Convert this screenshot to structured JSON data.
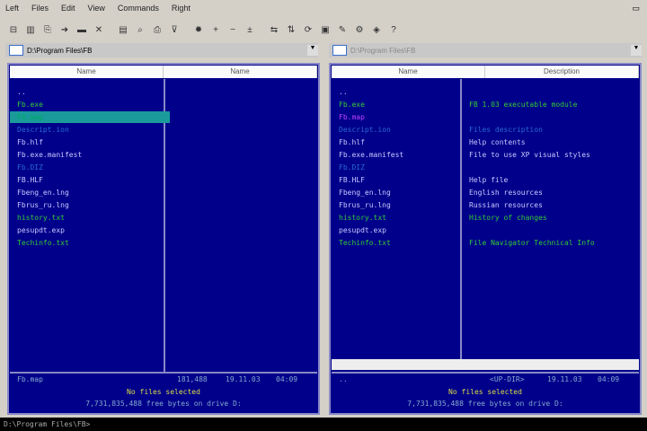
{
  "menu": [
    "Left",
    "Files",
    "Edit",
    "View",
    "Commands",
    "Right"
  ],
  "toolbar_icons": [
    "tree-icon",
    "split-icon",
    "copy-icon",
    "move-icon",
    "folder-icon",
    "delete-icon",
    "properties-icon",
    "find-icon",
    "print-icon",
    "filter-icon",
    "bulb-icon",
    "select-plus-icon",
    "select-minus-icon",
    "invert-icon",
    "compare-icon",
    "sort-icon",
    "refresh-icon",
    "view-icon",
    "edit-icon",
    "tools-icon",
    "plugins-icon",
    "help-icon"
  ],
  "left": {
    "path": "D:\\Program Files\\FB",
    "columns": [
      "Name",
      "Name"
    ],
    "files": [
      {
        "name": "..",
        "c": "#c8c8ff"
      },
      {
        "name": "Fb.exe",
        "c": "#33cc33"
      },
      {
        "name": "Fb.map",
        "c": "#0a6"
      },
      {
        "name": "Descript.ion",
        "c": "#2a6ad0"
      },
      {
        "name": "Fb.hlf",
        "c": "#c8c8ff"
      },
      {
        "name": "Fb.exe.manifest",
        "c": "#c8c8ff"
      },
      {
        "name": "Fb.DIZ",
        "c": "#2a6ad0"
      },
      {
        "name": "FB.HLF",
        "c": "#c8c8ff"
      },
      {
        "name": "Fbeng_en.lng",
        "c": "#c8c8ff"
      },
      {
        "name": "Fbrus_ru.lng",
        "c": "#c8c8ff"
      },
      {
        "name": "history.txt",
        "c": "#33cc33"
      },
      {
        "name": "pesupdt.exp",
        "c": "#c8c8ff"
      },
      {
        "name": "Techinfo.txt",
        "c": "#33cc33"
      }
    ],
    "status": {
      "name": "Fb.map",
      "size": "181,488",
      "date": "19.11.03",
      "time": "04:09",
      "selected": "No files selected",
      "free": "7,731,835,488 free bytes on drive D:"
    }
  },
  "right": {
    "path": "D:\\Program Files\\FB",
    "columns": [
      "Name",
      "Description"
    ],
    "files": [
      {
        "name": "..",
        "d": "",
        "c": "#c8c8ff"
      },
      {
        "name": "Fb.exe",
        "d": "FB 1.03 executable module",
        "c": "#33cc33"
      },
      {
        "name": "Fb.map",
        "d": "",
        "c": "#c040ff"
      },
      {
        "name": "Descript.ion",
        "d": "Files description",
        "c": "#2a6ad0"
      },
      {
        "name": "Fb.hlf",
        "d": "Help contents",
        "c": "#c8c8ff"
      },
      {
        "name": "Fb.exe.manifest",
        "d": "File to use XP visual styles",
        "c": "#c8c8ff"
      },
      {
        "name": "Fb.DIZ",
        "d": "",
        "c": "#2a6ad0"
      },
      {
        "name": "FB.HLF",
        "d": "Help file",
        "c": "#c8c8ff"
      },
      {
        "name": "Fbeng_en.lng",
        "d": "English resources",
        "c": "#c8c8ff"
      },
      {
        "name": "Fbrus_ru.lng",
        "d": "Russian resources",
        "c": "#c8c8ff"
      },
      {
        "name": "history.txt",
        "d": "History of changes",
        "c": "#33cc33"
      },
      {
        "name": "pesupdt.exp",
        "d": "",
        "c": "#c8c8ff"
      },
      {
        "name": "Techinfo.txt",
        "d": "File Navigator Technical Info",
        "c": "#33cc33"
      }
    ],
    "status": {
      "name": "..",
      "size": "<UP-DIR>",
      "date": "19.11.03",
      "time": "04:09",
      "selected": "No files selected",
      "free": "7,731,835,488 free bytes on drive D:"
    }
  },
  "cmdline": "D:\\Program Files\\FB>"
}
